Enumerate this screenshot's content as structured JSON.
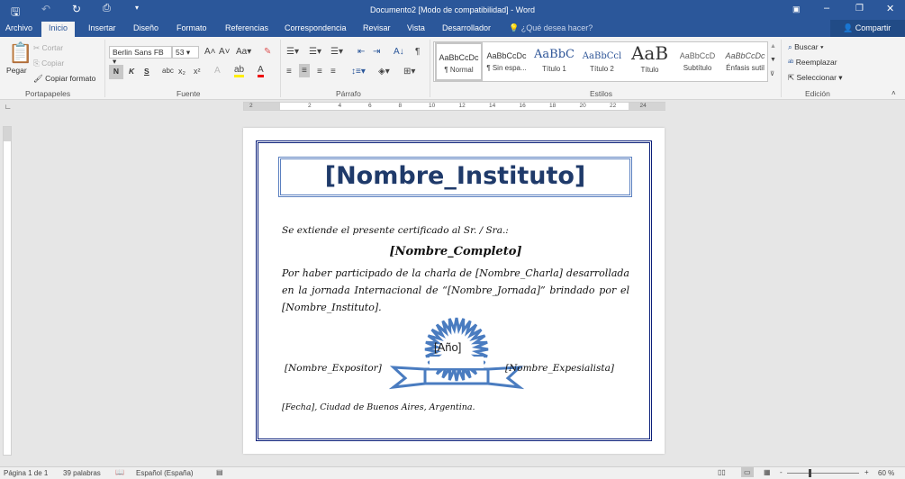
{
  "window": {
    "title": "Documento2 [Modo de compatibilidad] - Word"
  },
  "tabs": [
    "Archivo",
    "Inicio",
    "Insertar",
    "Diseño",
    "Formato",
    "Referencias",
    "Correspondencia",
    "Revisar",
    "Vista",
    "Desarrollador"
  ],
  "tell_me": "¿Qué desea hacer?",
  "share": "Compartir",
  "clipboard": {
    "paste": "Pegar",
    "cut": "Cortar",
    "copy": "Copiar",
    "format_painter": "Copiar formato",
    "label": "Portapapeles"
  },
  "font": {
    "name": "Berlin Sans FB",
    "size": "53",
    "label": "Fuente",
    "bold": "N",
    "italic": "K",
    "underline": "S"
  },
  "paragraph": {
    "label": "Párrafo"
  },
  "styles": {
    "label": "Estilos",
    "items": [
      {
        "preview": "AaBbCcDc",
        "name": "¶ Normal"
      },
      {
        "preview": "AaBbCcDc",
        "name": "¶ Sin espa..."
      },
      {
        "preview": "AaBbC",
        "name": "Título 1"
      },
      {
        "preview": "AaBbCcl",
        "name": "Título 2"
      },
      {
        "preview": "AaB",
        "name": "Título"
      },
      {
        "preview": "AaBbCcD",
        "name": "Subtítulo"
      },
      {
        "preview": "AaBbCcDc",
        "name": "Énfasis sutil"
      }
    ]
  },
  "editing": {
    "find": "Buscar",
    "replace": "Reemplazar",
    "select": "Seleccionar",
    "label": "Edición"
  },
  "ruler": [
    "2",
    "2",
    "4",
    "6",
    "8",
    "10",
    "12",
    "14",
    "16",
    "18",
    "20",
    "22",
    "24"
  ],
  "document": {
    "title": "[Nombre_Instituto]",
    "intro": "Se extiende el presente certificado al Sr. / Sra.:",
    "name": "[Nombre_Completo]",
    "body": "Por haber participado de la charla de [Nombre_Charla] desarrollada en la jornada Internacional de “[Nombre_Jornada]” brindado por el [Nombre_Instituto].",
    "year": "[Año]",
    "left_sign": "[Nombre_Expositor]",
    "right_sign": "[Nombre_Expesialista]",
    "footer": "[Fecha], Ciudad de Buenos Aires, Argentina."
  },
  "status": {
    "page": "Página 1 de 1",
    "words": "39 palabras",
    "language": "Español (España)",
    "zoom": "60 %",
    "zoom_percent": 60
  },
  "colors": {
    "accent": "#2b579a",
    "border": "#0b1f7a",
    "seal": "#4a7cc0"
  }
}
